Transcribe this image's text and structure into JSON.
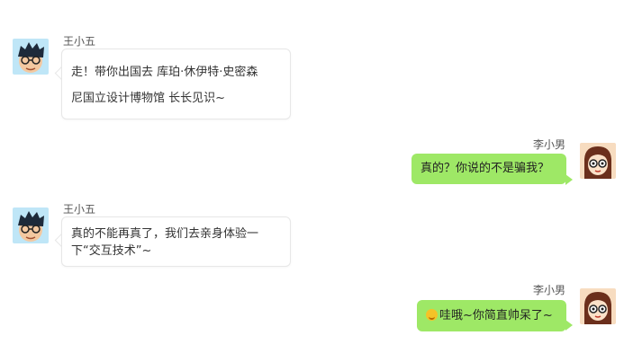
{
  "messages": [
    {
      "sender": "王小五",
      "side": "left",
      "lines": [
        "走！带你出国去 库珀·休伊特·史密森",
        "尼国立设计博物馆 长长见识~"
      ]
    },
    {
      "sender": "李小男",
      "side": "right",
      "lines": [
        "真的？你说的不是骗我？"
      ]
    },
    {
      "sender": "王小五",
      "side": "left",
      "lines": [
        "真的不能再真了，我们去亲身体验一",
        "下“交互技术”~"
      ]
    },
    {
      "sender": "李小男",
      "side": "right",
      "emoji": "grin-emoji",
      "lines": [
        "哇哦~你简直帅呆了~"
      ]
    }
  ],
  "colors": {
    "right_bubble": "#9ee866",
    "left_bubble": "#ffffff"
  }
}
